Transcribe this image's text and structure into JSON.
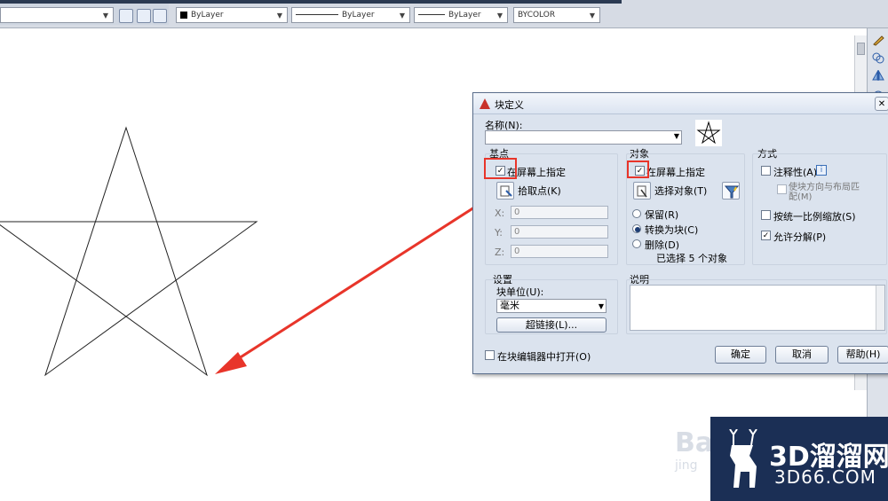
{
  "toolbar": {
    "color_combo": "ByLayer",
    "linetype_combo": "ByLayer",
    "lineweight_combo": "ByLayer",
    "plotstyle_combo": "BYCOLOR"
  },
  "dialog": {
    "title": "块定义",
    "name_label": "名称(N):",
    "name_value": "",
    "base_point": {
      "title": "基点",
      "specify_onscreen": "在屏幕上指定",
      "specify_checked": true,
      "pick_point": "拾取点(K)",
      "x_label": "X:",
      "x_value": "0",
      "y_label": "Y:",
      "y_value": "0",
      "z_label": "Z:",
      "z_value": "0"
    },
    "objects": {
      "title": "对象",
      "specify_onscreen": "在屏幕上指定",
      "specify_checked": true,
      "select_objects": "选择对象(T)",
      "retain": "保留(R)",
      "convert": "转换为块(C)",
      "delete": "删除(D)",
      "selected_option": "convert",
      "status": "已选择 5 个对象"
    },
    "behavior": {
      "title": "方式",
      "annotative": "注释性(A)",
      "annotative_checked": false,
      "match_orientation": "使块方向与布局匹配(M)",
      "scale_uniformly": "按统一比例缩放(S)",
      "scale_checked": false,
      "allow_explode": "允许分解(P)",
      "explode_checked": true
    },
    "settings": {
      "title": "设置",
      "unit_label": "块单位(U):",
      "unit_value": "毫米",
      "hyperlink_button": "超链接(L)..."
    },
    "description": {
      "title": "说明",
      "value": ""
    },
    "open_in_editor": "在块编辑器中打开(O)",
    "open_checked": false,
    "ok_button": "确定",
    "cancel_button": "取消",
    "help_button": "帮助(H)"
  },
  "watermark": {
    "brand": "3D溜溜网",
    "url": "3D66.COM",
    "baidu": "Ba",
    "baidu_sub": "jing"
  },
  "colors": {
    "annotation_red": "#e8352a",
    "dialog_bg": "#dbe3ee",
    "watermark_bg": "#1b2f55"
  }
}
